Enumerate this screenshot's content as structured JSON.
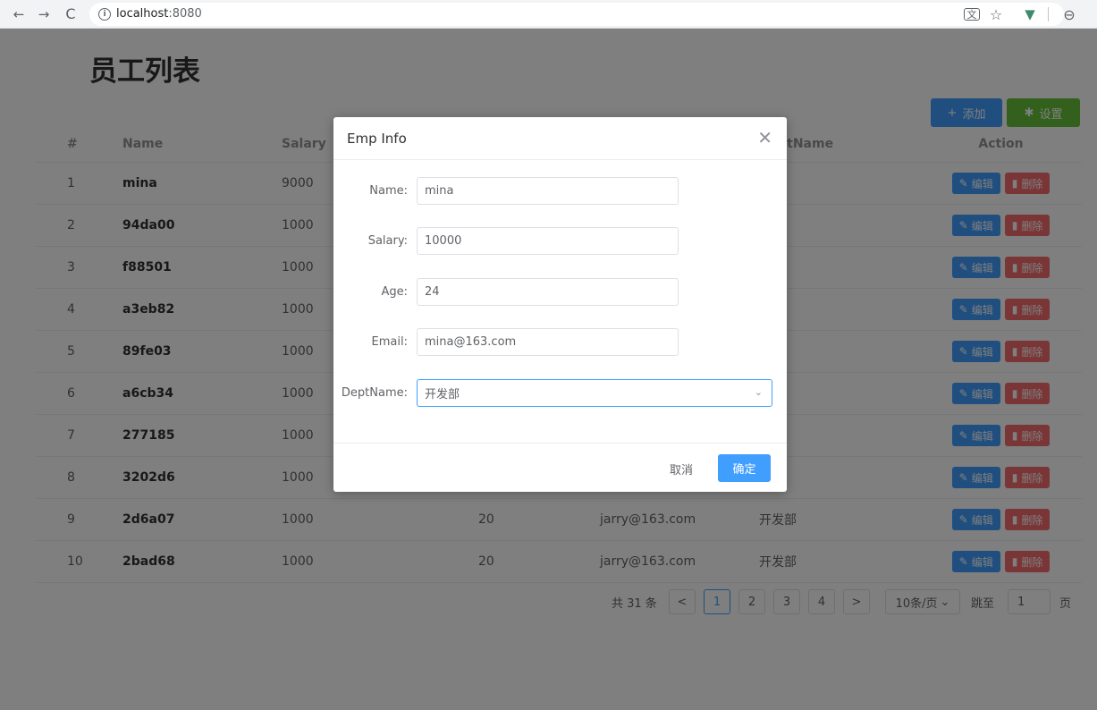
{
  "browser": {
    "host": "localhost",
    "port": ":8080"
  },
  "page": {
    "title": "员工列表",
    "add_label": "添加",
    "settings_label": "设置"
  },
  "table": {
    "headers": {
      "idx": "#",
      "name": "Name",
      "salary": "Salary",
      "dept": "DeptName",
      "action": "Action"
    },
    "edit_label": "编辑",
    "delete_label": "删除",
    "rows": [
      {
        "idx": "1",
        "name": "mina",
        "salary": "9000",
        "age": "",
        "email": "",
        "dept": "发部"
      },
      {
        "idx": "2",
        "name": "94da00",
        "salary": "1000",
        "age": "",
        "email": "",
        "dept": "发部"
      },
      {
        "idx": "3",
        "name": "f88501",
        "salary": "1000",
        "age": "",
        "email": "",
        "dept": "发部"
      },
      {
        "idx": "4",
        "name": "a3eb82",
        "salary": "1000",
        "age": "",
        "email": "",
        "dept": "发部"
      },
      {
        "idx": "5",
        "name": "89fe03",
        "salary": "1000",
        "age": "",
        "email": "",
        "dept": "发部"
      },
      {
        "idx": "6",
        "name": "a6cb34",
        "salary": "1000",
        "age": "",
        "email": "",
        "dept": "发部"
      },
      {
        "idx": "7",
        "name": "277185",
        "salary": "1000",
        "age": "",
        "email": "",
        "dept": "发部"
      },
      {
        "idx": "8",
        "name": "3202d6",
        "salary": "1000",
        "age": "",
        "email": "",
        "dept": "发部"
      },
      {
        "idx": "9",
        "name": "2d6a07",
        "salary": "1000",
        "age": "20",
        "email": "jarry@163.com",
        "dept": "开发部"
      },
      {
        "idx": "10",
        "name": "2bad68",
        "salary": "1000",
        "age": "20",
        "email": "jarry@163.com",
        "dept": "开发部"
      }
    ]
  },
  "pager": {
    "total": "共 31 条",
    "prev": "<",
    "next": ">",
    "pages": [
      "1",
      "2",
      "3",
      "4"
    ],
    "current": "1",
    "size": "10条/页",
    "jump": "跳至",
    "jump_value": "1",
    "unit": "页"
  },
  "dialog": {
    "title": "Emp Info",
    "name_label": "Name:",
    "name_value": "mina",
    "salary_label": "Salary:",
    "salary_value": "10000",
    "age_label": "Age:",
    "age_value": "24",
    "email_label": "Email:",
    "email_value": "mina@163.com",
    "dept_label": "DeptName:",
    "dept_value": "开发部",
    "cancel_label": "取消",
    "ok_label": "确定"
  },
  "colors": {
    "primary": "#409eff",
    "success": "#67c23a",
    "danger": "#f56c6c"
  }
}
